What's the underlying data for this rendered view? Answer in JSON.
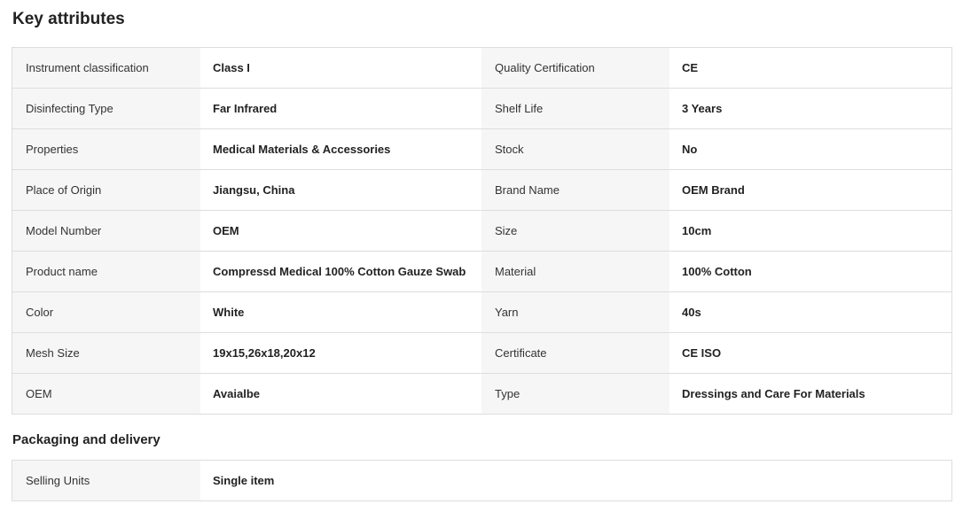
{
  "key_attributes": {
    "title": "Key attributes",
    "rows": [
      {
        "label1": "Instrument classification",
        "value1": "Class I",
        "label2": "Quality Certification",
        "value2": "CE"
      },
      {
        "label1": "Disinfecting Type",
        "value1": "Far Infrared",
        "label2": "Shelf Life",
        "value2": "3 Years"
      },
      {
        "label1": "Properties",
        "value1": "Medical Materials & Accessories",
        "label2": "Stock",
        "value2": "No"
      },
      {
        "label1": "Place of Origin",
        "value1": "Jiangsu, China",
        "label2": "Brand Name",
        "value2": "OEM Brand"
      },
      {
        "label1": "Model Number",
        "value1": "OEM",
        "label2": "Size",
        "value2": "10cm"
      },
      {
        "label1": "Product name",
        "value1": "Compressd Medical 100% Cotton Gauze Swab",
        "label2": "Material",
        "value2": "100% Cotton"
      },
      {
        "label1": "Color",
        "value1": "White",
        "label2": "Yarn",
        "value2": "40s"
      },
      {
        "label1": "Mesh Size",
        "value1": "19x15,26x18,20x12",
        "label2": "Certificate",
        "value2": "CE ISO"
      },
      {
        "label1": "OEM",
        "value1": "Avaialbe",
        "label2": "Type",
        "value2": "Dressings and Care For Materials"
      }
    ]
  },
  "packaging": {
    "title": "Packaging and delivery",
    "rows": [
      {
        "label": "Selling Units",
        "value": "Single item"
      }
    ]
  }
}
